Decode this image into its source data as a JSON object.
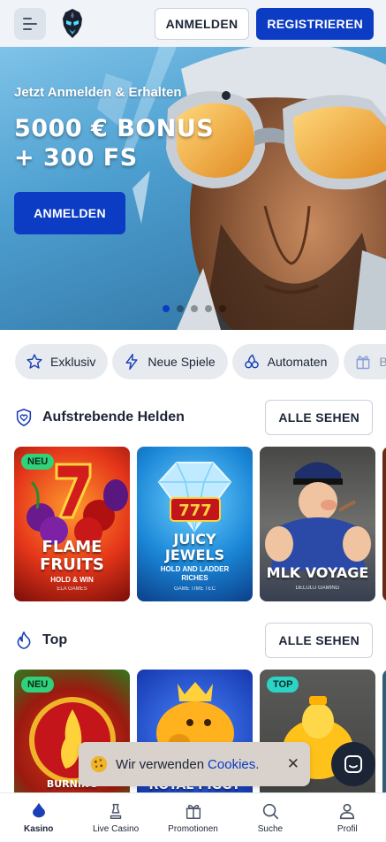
{
  "header": {
    "login_label": "ANMELDEN",
    "register_label": "REGISTRIEREN"
  },
  "hero": {
    "subtitle": "Jetzt Anmelden & Erhalten",
    "title_line1": "5000 € BONUS",
    "title_line2": "+ 300 FS",
    "cta_label": "ANMELDEN",
    "slides_total": 5,
    "active_slide": 1
  },
  "categories": [
    {
      "label": "Exklusiv",
      "icon": "star-icon"
    },
    {
      "label": "Neue Spiele",
      "icon": "lightning-icon"
    },
    {
      "label": "Automaten",
      "icon": "cherries-icon"
    },
    {
      "label": "B",
      "icon": "gift-icon"
    }
  ],
  "sections": [
    {
      "title": "Aufstrebende Helden",
      "see_all_label": "ALLE SEHEN",
      "icon": "heart-shield-icon",
      "games": [
        {
          "name_line1": "FLAME",
          "name_line2": "FRUITS",
          "subtitle": "HOLD & WIN",
          "provider": "ELA GAMES",
          "badge": "NEU"
        },
        {
          "name_line1": "JUICY",
          "name_line2": "JEWELS",
          "subtitle": "HOLD AND LADDER RICHES",
          "provider": "GAME TIME TEC",
          "badge": ""
        },
        {
          "name_line1": "MLK VOYAGE",
          "name_line2": "",
          "subtitle": "",
          "provider": "DELULU GAMING",
          "badge": ""
        }
      ]
    },
    {
      "title": "Top",
      "see_all_label": "ALLE SEHEN",
      "icon": "flame-icon",
      "games": [
        {
          "name_line1": "BURNING",
          "badge": "NEU"
        },
        {
          "name_line1": "ROYAL PIGGY",
          "badge": ""
        },
        {
          "name_line1": "",
          "badge": "TOP"
        }
      ]
    }
  ],
  "cookie": {
    "text": "Wir verwenden",
    "link": "Cookies.",
    "close": "✕"
  },
  "bottom_nav": [
    {
      "label": "Kasino",
      "icon": "diamond-icon",
      "active": true
    },
    {
      "label": "Live Casino",
      "icon": "chess-icon",
      "active": false
    },
    {
      "label": "Promotionen",
      "icon": "gift-icon",
      "active": false
    },
    {
      "label": "Suche",
      "icon": "search-icon",
      "active": false
    },
    {
      "label": "Profil",
      "icon": "user-icon",
      "active": false
    }
  ],
  "colors": {
    "primary": "#0c3bc4",
    "header_bg": "#f0f3f7",
    "chip_bg": "#e7ebf0",
    "badge_new": "#2fd27a",
    "badge_top": "#2bd4c5"
  }
}
